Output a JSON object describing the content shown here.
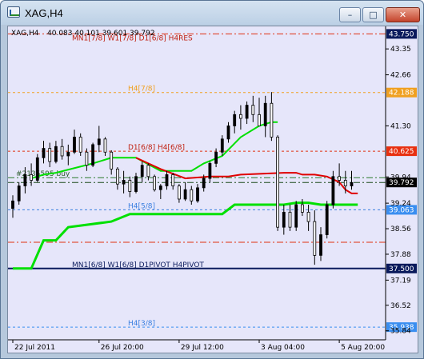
{
  "window": {
    "title": "XAG,H4",
    "minimize_glyph": "–",
    "maximize_glyph": "□",
    "close_glyph": "✕"
  },
  "chart_header": {
    "symbol": "XAG,H4",
    "ohlc": "40.083 40.101 39.601 39.792"
  },
  "chart_data": {
    "type": "candlestick",
    "symbol": "XAG",
    "timeframe": "H4",
    "ylim": [
      35.6,
      43.95
    ],
    "xlim": [
      0,
      60
    ],
    "y_ticks": [
      43.35,
      42.66,
      41.3,
      39.94,
      39.24,
      38.56,
      37.88,
      37.19,
      36.52,
      35.84
    ],
    "x_ticks": [
      {
        "x": 0,
        "label": "22 Jul 2011"
      },
      {
        "x": 14,
        "label": "26 Jul 20:00"
      },
      {
        "x": 27,
        "label": "29 Jul 12:00"
      },
      {
        "x": 40,
        "label": "3 Aug 04:00"
      },
      {
        "x": 53,
        "label": "5 Aug 20:00"
      }
    ],
    "current_price": 39.792,
    "levels": [
      {
        "price": 43.75,
        "label": "MN1[7/8] W1[7/8] D1[6/8] H4RES",
        "color": "#e03010",
        "style": "dashdot",
        "tag_color": "#0a1a5c"
      },
      {
        "price": 42.188,
        "label": "H4[7/8]",
        "color": "#f0a020",
        "style": "dash",
        "tag_color": "#f0a020"
      },
      {
        "price": 40.625,
        "label": "D1[6/8] H4[6/8]",
        "color": "#e03010",
        "style": "dash",
        "tag_color": "#e83010"
      },
      {
        "price": 39.063,
        "label": "H4[5/8]",
        "color": "#3a7fe0",
        "style": "dash",
        "tag_color": "#3a8ef0"
      },
      {
        "price": 38.2,
        "label": "",
        "color": "#e03010",
        "style": "dashdot",
        "tag_color": ""
      },
      {
        "price": 37.5,
        "label": "MN1[6/8] W1[6/8] D1PIVOT H4PIVOT",
        "color": "#0a1a5c",
        "style": "solid",
        "tag_color": "#0a1a5c"
      },
      {
        "price": 35.938,
        "label": "H4[3/8]",
        "color": "#3a8ef0",
        "style": "dash",
        "tag_color": "#3a8ef0"
      }
    ],
    "order_line": {
      "price": 39.92,
      "label": "#2135595 buy"
    },
    "candles": [
      [
        39.1,
        39.45,
        38.85,
        39.3
      ],
      [
        39.3,
        39.8,
        39.2,
        39.7
      ],
      [
        39.7,
        40.2,
        39.5,
        40.0
      ],
      [
        40.0,
        40.3,
        39.7,
        39.85
      ],
      [
        39.85,
        40.55,
        39.8,
        40.45
      ],
      [
        40.45,
        40.9,
        40.3,
        40.7
      ],
      [
        40.7,
        40.85,
        40.2,
        40.35
      ],
      [
        40.35,
        40.9,
        40.3,
        40.75
      ],
      [
        40.75,
        40.95,
        40.4,
        40.5
      ],
      [
        40.5,
        40.8,
        40.25,
        40.6
      ],
      [
        40.6,
        41.2,
        40.55,
        41.0
      ],
      [
        41.0,
        41.1,
        40.5,
        40.6
      ],
      [
        40.6,
        40.7,
        40.1,
        40.25
      ],
      [
        40.25,
        40.85,
        40.2,
        40.8
      ],
      [
        40.8,
        41.3,
        40.6,
        40.95
      ],
      [
        40.95,
        41.0,
        40.5,
        40.6
      ],
      [
        40.6,
        40.65,
        40.0,
        40.15
      ],
      [
        40.15,
        40.2,
        39.6,
        39.75
      ],
      [
        39.75,
        40.1,
        39.5,
        39.85
      ],
      [
        39.85,
        39.95,
        39.4,
        39.55
      ],
      [
        39.55,
        40.05,
        39.5,
        39.95
      ],
      [
        39.95,
        40.35,
        39.8,
        40.25
      ],
      [
        40.25,
        40.3,
        39.85,
        39.95
      ],
      [
        39.95,
        40.0,
        39.55,
        39.6
      ],
      [
        39.6,
        39.75,
        39.35,
        39.7
      ],
      [
        39.7,
        40.1,
        39.6,
        40.0
      ],
      [
        40.0,
        40.05,
        39.6,
        39.7
      ],
      [
        39.7,
        39.75,
        39.25,
        39.35
      ],
      [
        39.35,
        39.8,
        39.3,
        39.6
      ],
      [
        39.6,
        39.7,
        39.2,
        39.3
      ],
      [
        39.3,
        39.75,
        39.25,
        39.65
      ],
      [
        39.65,
        40.0,
        39.55,
        39.9
      ],
      [
        39.9,
        40.35,
        39.8,
        40.3
      ],
      [
        40.3,
        40.7,
        40.2,
        40.6
      ],
      [
        40.6,
        41.05,
        40.5,
        40.95
      ],
      [
        40.95,
        41.4,
        40.85,
        41.3
      ],
      [
        41.3,
        41.7,
        41.1,
        41.6
      ],
      [
        41.6,
        41.85,
        41.2,
        41.5
      ],
      [
        41.5,
        41.95,
        41.35,
        41.85
      ],
      [
        41.85,
        42.1,
        41.4,
        41.6
      ],
      [
        41.6,
        42.05,
        41.35,
        41.3
      ],
      [
        41.3,
        42.1,
        41.0,
        41.9
      ],
      [
        41.9,
        42.2,
        40.9,
        41.0
      ],
      [
        41.0,
        41.05,
        38.5,
        38.6
      ],
      [
        38.6,
        39.2,
        38.4,
        39.0
      ],
      [
        39.0,
        39.2,
        38.5,
        38.6
      ],
      [
        38.6,
        39.3,
        38.5,
        39.2
      ],
      [
        39.2,
        39.35,
        38.9,
        39.0
      ],
      [
        39.0,
        39.2,
        38.5,
        38.75
      ],
      [
        38.75,
        39.05,
        37.6,
        37.85
      ],
      [
        37.85,
        38.6,
        37.7,
        38.4
      ],
      [
        38.4,
        39.3,
        38.3,
        39.2
      ],
      [
        39.2,
        40.1,
        39.1,
        39.95
      ],
      [
        39.95,
        40.3,
        39.7,
        39.85
      ],
      [
        39.85,
        40.1,
        39.5,
        39.7
      ],
      [
        39.7,
        40.1,
        39.6,
        39.79
      ]
    ],
    "red_line": [
      [
        20,
        40.45
      ],
      [
        24,
        40.15
      ],
      [
        28,
        39.9
      ],
      [
        32,
        39.95
      ],
      [
        35,
        39.95
      ],
      [
        37,
        40.0
      ],
      [
        44,
        40.05
      ],
      [
        45,
        40.05
      ],
      [
        46,
        40.05
      ],
      [
        47,
        40.0
      ],
      [
        49,
        40.0
      ],
      [
        51,
        39.95
      ],
      [
        53,
        39.8
      ],
      [
        54,
        39.6
      ],
      [
        55,
        39.5
      ],
      [
        56,
        39.5
      ]
    ],
    "green_line": [
      [
        0,
        37.5
      ],
      [
        3,
        37.5
      ],
      [
        5,
        38.25
      ],
      [
        7,
        38.25
      ],
      [
        9,
        38.6
      ],
      [
        16,
        38.75
      ],
      [
        19,
        38.95
      ],
      [
        34,
        38.95
      ],
      [
        36,
        39.2
      ],
      [
        44,
        39.2
      ],
      [
        46,
        39.25
      ],
      [
        48,
        39.25
      ],
      [
        50,
        39.2
      ],
      [
        52,
        39.2
      ],
      [
        56,
        39.2
      ]
    ],
    "green_upper": [
      [
        3,
        39.9
      ],
      [
        5,
        40.0
      ],
      [
        7,
        40.05
      ],
      [
        13,
        40.3
      ],
      [
        16,
        40.45
      ],
      [
        18,
        40.45
      ],
      [
        20,
        40.45
      ],
      [
        24,
        40.1
      ],
      [
        27,
        40.1
      ],
      [
        29,
        40.1
      ],
      [
        31,
        40.3
      ],
      [
        34,
        40.5
      ],
      [
        37,
        41.0
      ],
      [
        40,
        41.3
      ],
      [
        42,
        41.4
      ],
      [
        43,
        41.4
      ]
    ],
    "colors": {
      "background": "#e6e6fa",
      "axis_text": "#000000",
      "candle_up": "#000000",
      "candle_down": "#000000",
      "red_line": "#e00000",
      "green_line": "#00e000",
      "order_line": "#2a7a2a",
      "current_price_tag": "#000000"
    }
  }
}
